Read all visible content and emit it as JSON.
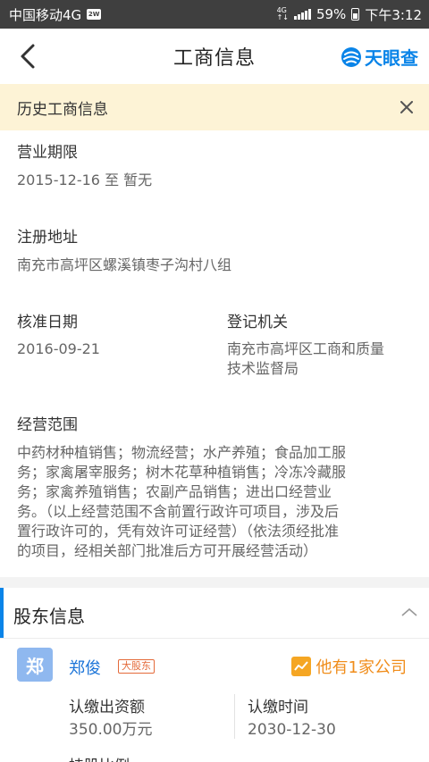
{
  "status_bar": {
    "carrier": "中国移动4G",
    "network": "4G",
    "battery": "59%",
    "time": "下午3:12"
  },
  "header": {
    "title": "工商信息",
    "brand": "天眼查"
  },
  "banner": {
    "text": "历史工商信息"
  },
  "fields": {
    "term_label": "营业期限",
    "term_value": "2015-12-16 至 暂无",
    "address_label": "注册地址",
    "address_value": "南充市高坪区螺溪镇枣子沟村八组",
    "approval_label": "核准日期",
    "approval_value": "2016-09-21",
    "authority_label": "登记机关",
    "authority_value_line1": "南充市高坪区工商和质量",
    "authority_value_line2": "技术监督局",
    "scope_label": "经营范围",
    "scope_lines": [
      "中药材种植销售；物流经营；水产养殖；食品加工服",
      "务；家禽屠宰服务；树木花草种植销售；冷冻冷藏服",
      "务；家禽养殖销售；农副产品销售；进出口经营业",
      "务。（以上经营范围不含前置行政许可项目，涉及后",
      "置行政许可的，凭有效许可证经营）（依法须经批准",
      "的项目，经相关部门批准后方可开展经营活动）"
    ]
  },
  "shareholders": {
    "section_title": "股东信息",
    "holder": {
      "avatar": "郑",
      "name": "郑俊",
      "tag": "大股东",
      "companies_link": "他有1家公司",
      "contribution_label": "认缴出资额",
      "contribution_value": "350.00万元",
      "date_label": "认缴时间",
      "date_value": "2030-12-30",
      "ratio_label_partial": "持股比例"
    }
  },
  "colors": {
    "brand_blue": "#0a84e8",
    "banner_bg": "#fdf3d6",
    "link_orange": "#f08d1b",
    "tag_red": "#e46a3a"
  }
}
